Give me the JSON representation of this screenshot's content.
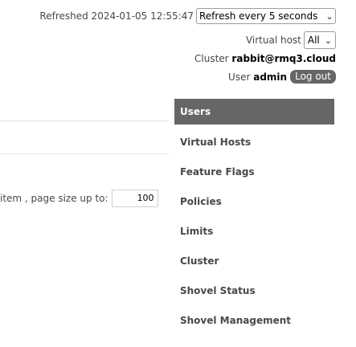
{
  "header": {
    "refreshed_label": "Refreshed 2024-01-05 12:55:47",
    "refresh_select": "Refresh every 5 seconds",
    "vhost_label": "Virtual host",
    "vhost_select": "All",
    "cluster_label": "Cluster",
    "cluster_name": "rabbit@rmq3.cloud",
    "user_label": "User",
    "user_name": "admin",
    "logout_label": "Log out"
  },
  "pagination": {
    "label": "item , page size up to:",
    "page_size": "100"
  },
  "admin_nav": {
    "items": [
      {
        "label": "Users",
        "active": true
      },
      {
        "label": "Virtual Hosts",
        "active": false
      },
      {
        "label": "Feature Flags",
        "active": false
      },
      {
        "label": "Policies",
        "active": false
      },
      {
        "label": "Limits",
        "active": false
      },
      {
        "label": "Cluster",
        "active": false
      },
      {
        "label": "Shovel Status",
        "active": false
      },
      {
        "label": "Shovel Management",
        "active": false
      }
    ]
  },
  "icons": {
    "dropdown": "chevron-down-icon"
  }
}
